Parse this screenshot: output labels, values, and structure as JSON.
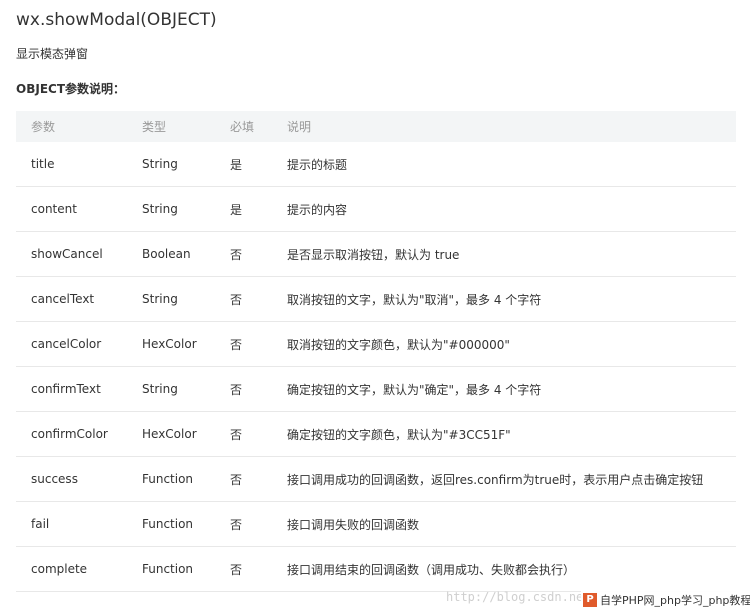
{
  "page": {
    "title": "wx.showModal(OBJECT)",
    "subtitle": "显示模态弹窗",
    "section_heading": "OBJECT参数说明："
  },
  "table": {
    "headers": [
      "参数",
      "类型",
      "必填",
      "说明"
    ],
    "rows": [
      [
        "title",
        "String",
        "是",
        "提示的标题"
      ],
      [
        "content",
        "String",
        "是",
        "提示的内容"
      ],
      [
        "showCancel",
        "Boolean",
        "否",
        "是否显示取消按钮，默认为 true"
      ],
      [
        "cancelText",
        "String",
        "否",
        "取消按钮的文字，默认为\"取消\"，最多 4 个字符"
      ],
      [
        "cancelColor",
        "HexColor",
        "否",
        "取消按钮的文字颜色，默认为\"#000000\""
      ],
      [
        "confirmText",
        "String",
        "否",
        "确定按钮的文字，默认为\"确定\"，最多 4 个字符"
      ],
      [
        "confirmColor",
        "HexColor",
        "否",
        "确定按钮的文字颜色，默认为\"#3CC51F\""
      ],
      [
        "success",
        "Function",
        "否",
        "接口调用成功的回调函数，返回res.confirm为true时，表示用户点击确定按钮"
      ],
      [
        "fail",
        "Function",
        "否",
        "接口调用失败的回调函数"
      ],
      [
        "complete",
        "Function",
        "否",
        "接口调用结束的回调函数（调用成功、失败都会执行）"
      ]
    ]
  },
  "watermark": {
    "url_text": "http://blog.csdn.net/",
    "badge_icon": "P",
    "badge_text": "自学PHP网_php学习_php教程"
  },
  "colors": {
    "header_bg": "#f3f5f6",
    "header_text": "#999999",
    "body_text": "#333333",
    "row_border": "#e8e8e8"
  }
}
